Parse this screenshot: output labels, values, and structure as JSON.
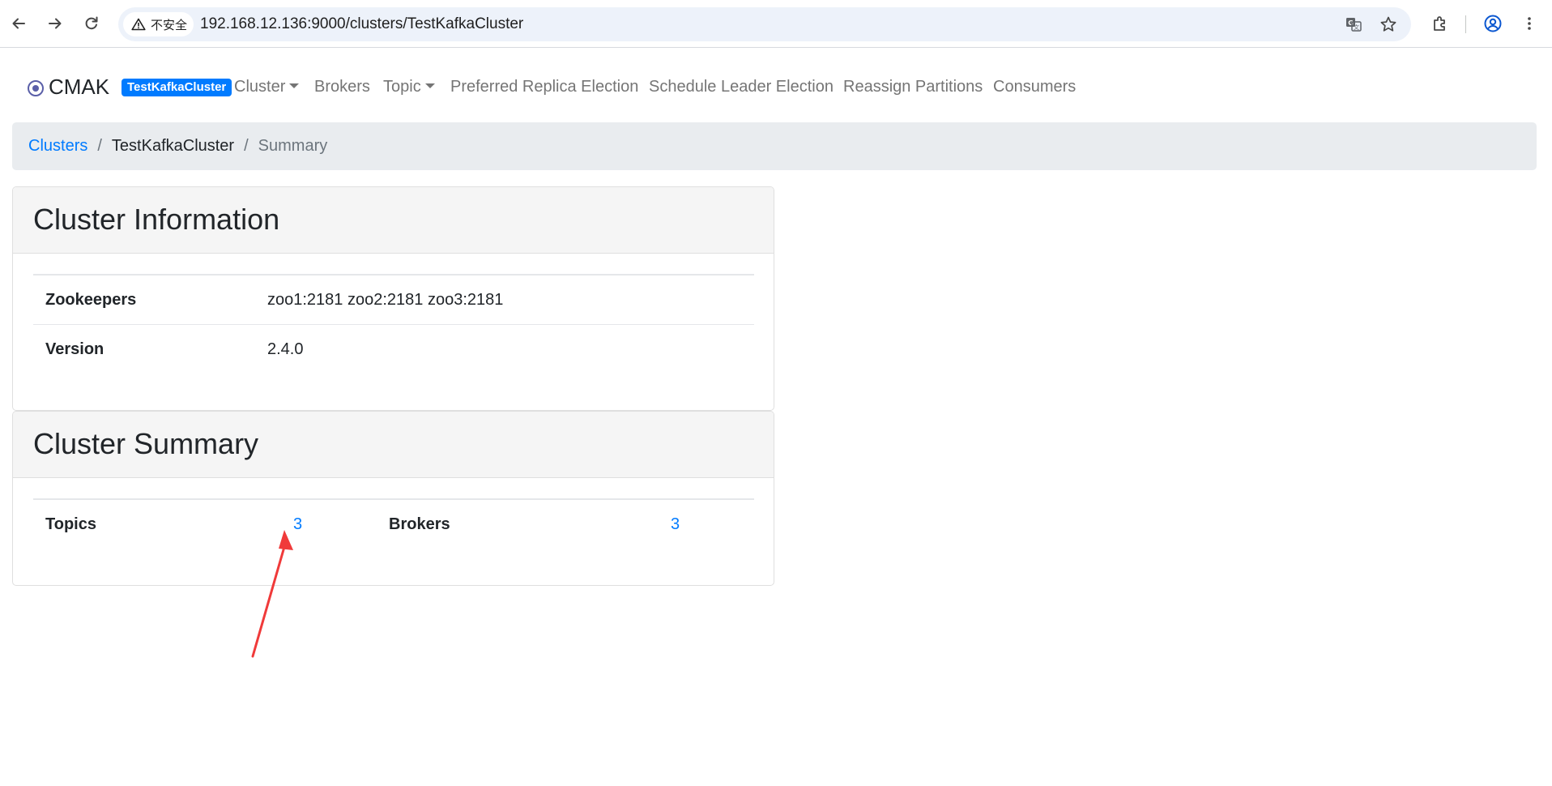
{
  "browser": {
    "security_label": "不安全",
    "url": "192.168.12.136:9000/clusters/TestKafkaCluster"
  },
  "navbar": {
    "brand": "CMAK",
    "cluster_badge": "TestKafkaCluster",
    "items": [
      {
        "label": "Cluster",
        "dropdown": true
      },
      {
        "label": "Brokers",
        "dropdown": false
      },
      {
        "label": "Topic",
        "dropdown": true
      },
      {
        "label": "Preferred Replica Election",
        "dropdown": false
      },
      {
        "label": "Schedule Leader Election",
        "dropdown": false
      },
      {
        "label": "Reassign Partitions",
        "dropdown": false
      },
      {
        "label": "Consumers",
        "dropdown": false
      }
    ]
  },
  "breadcrumb": {
    "items": [
      "Clusters",
      "TestKafkaCluster",
      "Summary"
    ],
    "separator": "/"
  },
  "cluster_information": {
    "title": "Cluster Information",
    "rows": [
      {
        "label": "Zookeepers",
        "value": "zoo1:2181 zoo2:2181 zoo3:2181"
      },
      {
        "label": "Version",
        "value": "2.4.0"
      }
    ]
  },
  "cluster_summary": {
    "title": "Cluster Summary",
    "topics_label": "Topics",
    "topics_value": "3",
    "brokers_label": "Brokers",
    "brokers_value": "3"
  },
  "colors": {
    "link": "#007bff",
    "badge": "#007bff",
    "annotation_arrow": "#f03a3a"
  }
}
